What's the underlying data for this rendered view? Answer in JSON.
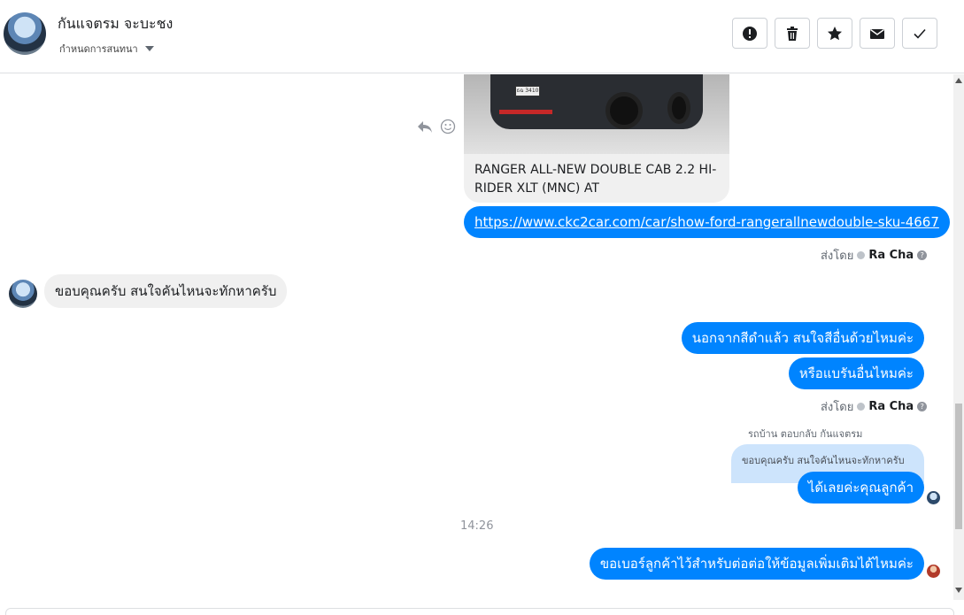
{
  "header": {
    "contact_name": "กันแจตรม จะบะชง",
    "assign_label": "กำหนดการสนทนา"
  },
  "toolbar": {
    "buttons": [
      {
        "name": "spam",
        "icon": "alert-icon"
      },
      {
        "name": "delete",
        "icon": "trash-icon"
      },
      {
        "name": "star",
        "icon": "star-icon"
      },
      {
        "name": "unread",
        "icon": "envelope-icon"
      },
      {
        "name": "done",
        "icon": "check-icon"
      }
    ]
  },
  "link_card": {
    "plate": "ธฉ 3410",
    "title": "RANGER ALL-NEW DOUBLE CAB 2.2 HI-RIDER XLT (MNC) AT"
  },
  "messages": {
    "link": "https://www.ckc2car.com/car/show-ford-rangerallnewdouble-sku-4667",
    "incoming_1": "ขอบคุณครับ สนใจคันไหนจะทักหาครับ",
    "out_2": "นอกจากสีดำแล้ว สนใจสีอื่นด้วยไหมค่ะ",
    "out_3": "หรือแบรันอื่นไหมค่ะ",
    "reply_label": "รถบ้าน ตอบกลับ กันแจตรม",
    "quoted": "ขอบคุณครับ สนใจคันไหนจะทักหาครับ",
    "out_4": "ได้เลยค่ะคุณลูกค้า",
    "timestamp": "14:26",
    "out_5": "ขอเบอร์ลูกค้าไว้สำหรับต่อต่อให้ข้อมูลเพิ่มเติมได้ไหมค่ะ"
  },
  "sent_by": {
    "prefix": "ส่งโดย",
    "name": "Ra Cha"
  },
  "colors": {
    "outgoing": "#0084ff",
    "incoming": "#f0f0f0",
    "quoted": "#cde4fc"
  }
}
